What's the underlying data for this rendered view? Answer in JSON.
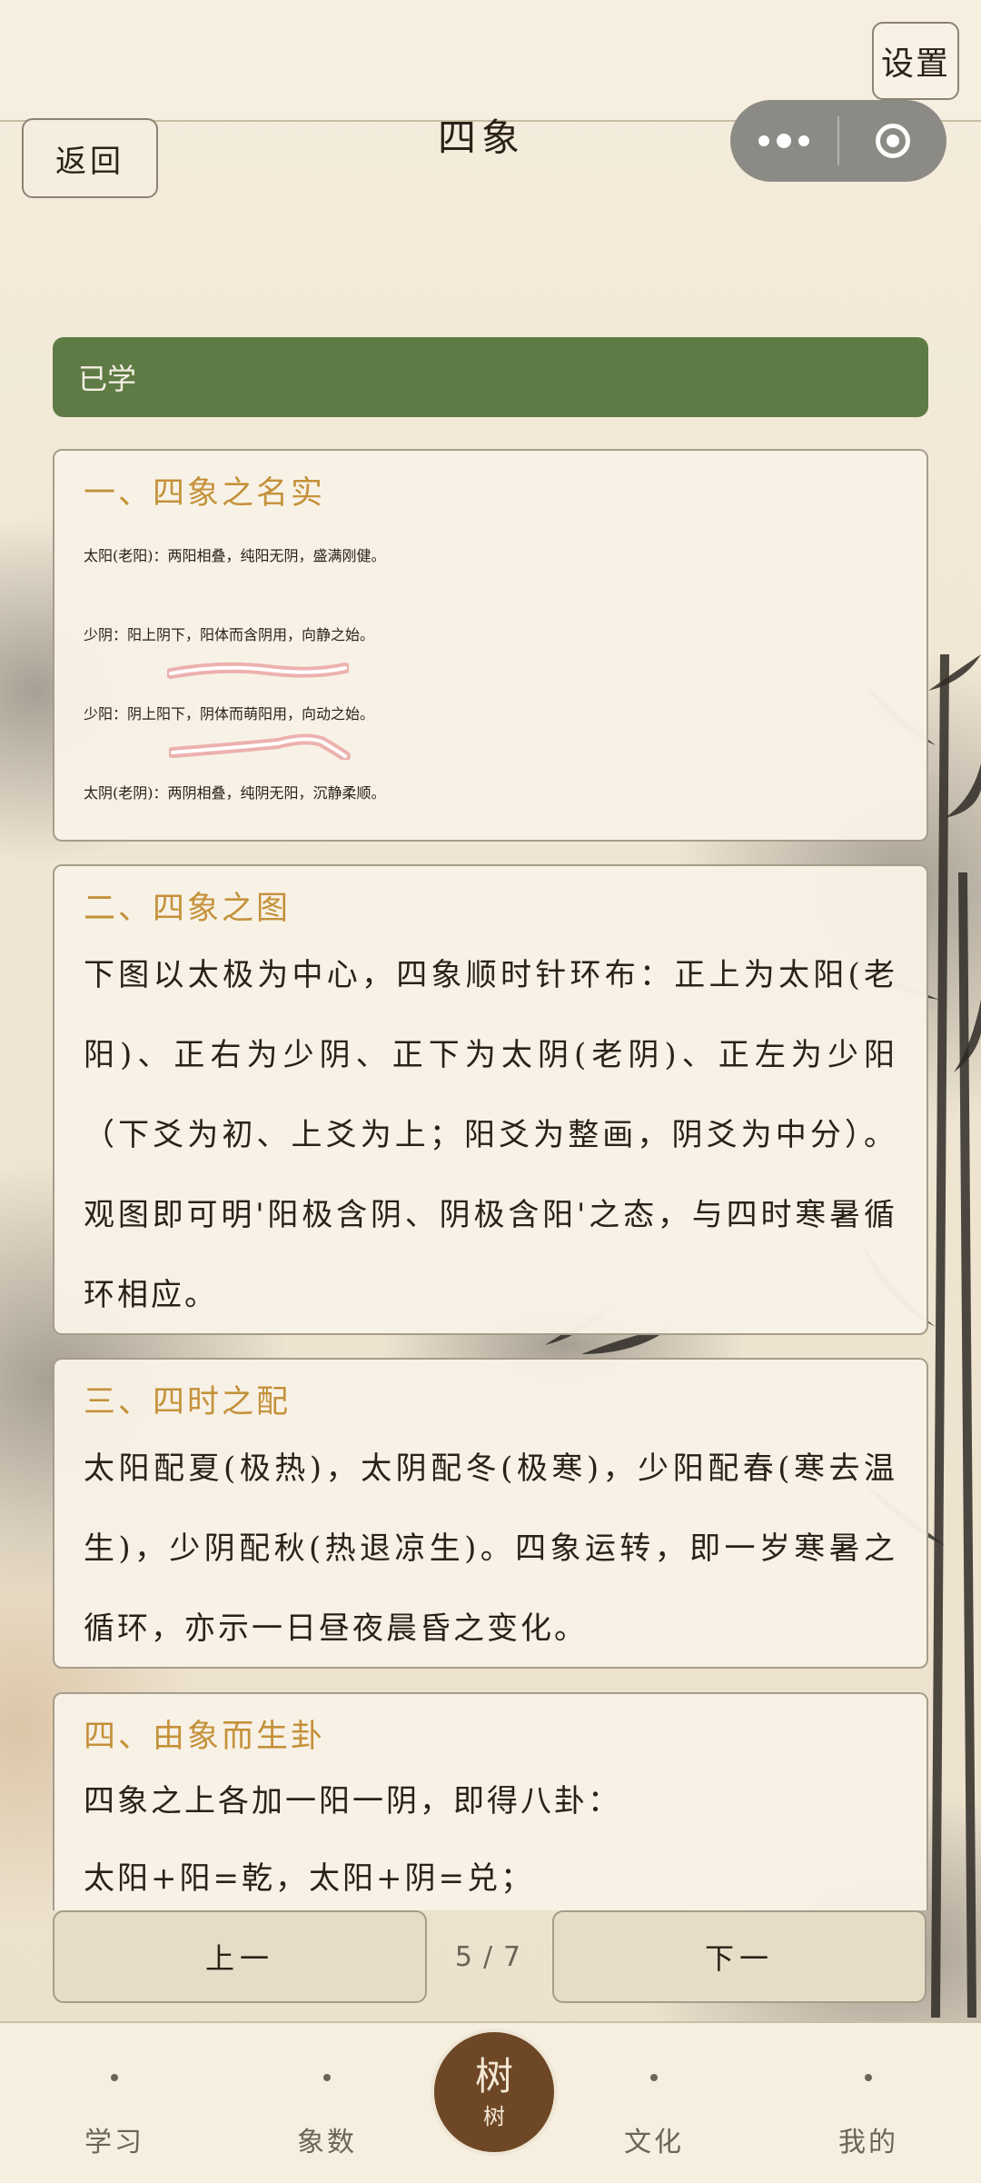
{
  "header": {
    "settings_label": "设置",
    "back_label": "返回",
    "title": "四象"
  },
  "status": {
    "label": "已学"
  },
  "sections": [
    {
      "heading": "一、四象之名实",
      "lines": [
        "太阳(老阳)：两阳相叠，纯阳无阴，盛满刚健。",
        "少阴：阳上阴下，阳体而含阴用，向静之始。",
        "少阳：阴上阳下，阴体而萌阳用，向动之始。",
        "太阴(老阴)：两阴相叠，纯阴无阳，沉静柔顺。"
      ]
    },
    {
      "heading": "二、四象之图",
      "text": "下图以太极为中心，四象顺时针环布：正上为太阳(老阳)、正右为少阴、正下为太阴(老阴)、正左为少阳（下爻为初、上爻为上；阳爻为整画，阴爻为中分）。观图即可明'阳极含阴、阴极含阳'之态，与四时寒暑循环相应。"
    },
    {
      "heading": "三、四时之配",
      "text": "太阳配夏(极热)，太阴配冬(极寒)，少阳配春(寒去温生)，少阴配秋(热退凉生)。四象运转，即一岁寒暑之循环，亦示一日昼夜晨昏之变化。"
    },
    {
      "heading": "四、由象而生卦",
      "lines": [
        "四象之上各加一阳一阴，即得八卦：",
        "太阳+阳=乾，太阳+阴=兑；"
      ]
    }
  ],
  "pager": {
    "prev_label": "上一",
    "next_label": "下一",
    "current": "5",
    "separator": "/",
    "total": "7"
  },
  "tabs": {
    "study": "学习",
    "xiangshu": "象数",
    "center_big": "树",
    "center_small": "树",
    "culture": "文化",
    "mine": "我的"
  }
}
